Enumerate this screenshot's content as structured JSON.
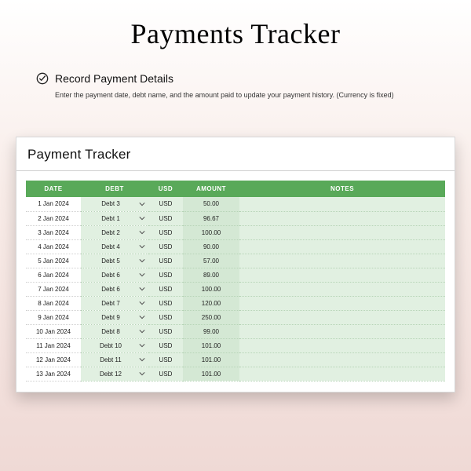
{
  "title": "Payments Tracker",
  "intro": {
    "heading": "Record Payment Details",
    "desc": "Enter the payment date, debt name, and the amount paid to update your payment history. (Currency is fixed)"
  },
  "sheet": {
    "title": "Payment Tracker",
    "columns": {
      "date": "DATE",
      "debt": "DEBT",
      "usd": "USD",
      "amount": "AMOUNT",
      "notes": "NOTES"
    },
    "rows": [
      {
        "date": "1 Jan 2024",
        "debt": "Debt 3",
        "usd": "USD",
        "amount": "50.00",
        "notes": ""
      },
      {
        "date": "2 Jan 2024",
        "debt": "Debt 1",
        "usd": "USD",
        "amount": "96.67",
        "notes": ""
      },
      {
        "date": "3 Jan 2024",
        "debt": "Debt 2",
        "usd": "USD",
        "amount": "100.00",
        "notes": ""
      },
      {
        "date": "4 Jan 2024",
        "debt": "Debt 4",
        "usd": "USD",
        "amount": "90.00",
        "notes": ""
      },
      {
        "date": "5 Jan 2024",
        "debt": "Debt 5",
        "usd": "USD",
        "amount": "57.00",
        "notes": ""
      },
      {
        "date": "6 Jan 2024",
        "debt": "Debt 6",
        "usd": "USD",
        "amount": "89.00",
        "notes": ""
      },
      {
        "date": "7 Jan 2024",
        "debt": "Debt 6",
        "usd": "USD",
        "amount": "100.00",
        "notes": ""
      },
      {
        "date": "8 Jan 2024",
        "debt": "Debt 7",
        "usd": "USD",
        "amount": "120.00",
        "notes": ""
      },
      {
        "date": "9 Jan 2024",
        "debt": "Debt 9",
        "usd": "USD",
        "amount": "250.00",
        "notes": ""
      },
      {
        "date": "10 Jan 2024",
        "debt": "Debt 8",
        "usd": "USD",
        "amount": "99.00",
        "notes": ""
      },
      {
        "date": "11 Jan 2024",
        "debt": "Debt 10",
        "usd": "USD",
        "amount": "101.00",
        "notes": ""
      },
      {
        "date": "12 Jan 2024",
        "debt": "Debt 11",
        "usd": "USD",
        "amount": "101.00",
        "notes": ""
      },
      {
        "date": "13 Jan 2024",
        "debt": "Debt 12",
        "usd": "USD",
        "amount": "101.00",
        "notes": ""
      }
    ]
  }
}
